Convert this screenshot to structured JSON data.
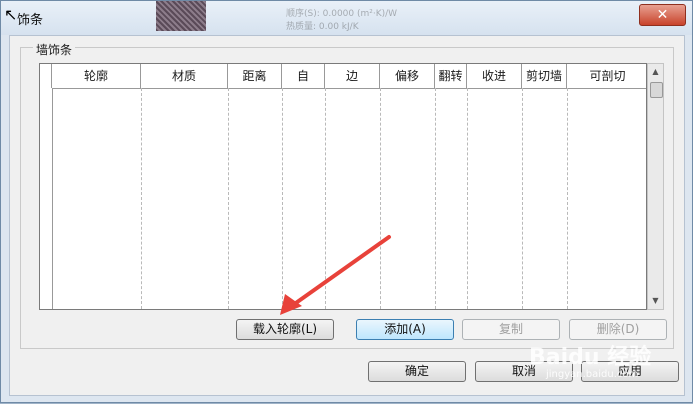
{
  "window": {
    "title": "饰条",
    "close_glyph": "✕"
  },
  "background_doc": {
    "line1": "顺序(S):    0.0000  (m²·K)/W",
    "line2": "热质量:     0.00  kJ/K"
  },
  "group": {
    "label": "墙饰条"
  },
  "table": {
    "columns": [
      "轮廓",
      "材质",
      "距离",
      "自",
      "边",
      "偏移",
      "翻转",
      "收进",
      "剪切墙",
      "可剖切"
    ],
    "rows": []
  },
  "buttons": {
    "load_profile": "载入轮廓(L)",
    "add": "添加(A)",
    "copy": "复制",
    "delete": "删除(D)",
    "ok": "确定",
    "cancel": "取消",
    "apply": "应用"
  },
  "watermark": {
    "brand": "Baidu 经验",
    "sub": "jingyan.baidu.com"
  },
  "colors": {
    "annotation_arrow": "#e8423a",
    "close_button": "#c8432b"
  }
}
